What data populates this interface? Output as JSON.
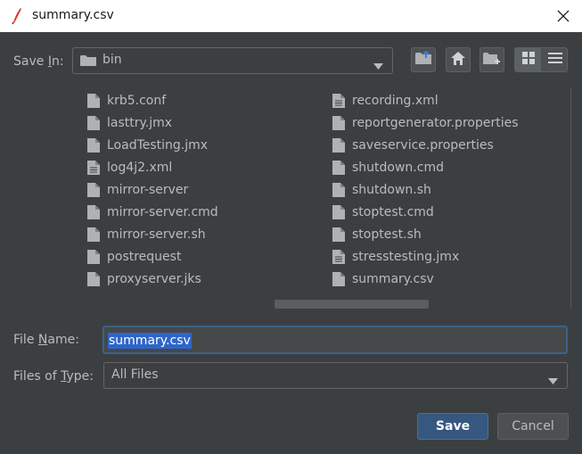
{
  "window": {
    "title": "summary.csv"
  },
  "save_in": {
    "label_pre": "Save ",
    "label_mnemonic": "I",
    "label_post": "n:",
    "value": "bin"
  },
  "files": {
    "left": [
      {
        "name": "krb5.conf",
        "icon": "file-icon"
      },
      {
        "name": "lasttry.jmx",
        "icon": "file-icon"
      },
      {
        "name": "LoadTesting.jmx",
        "icon": "file-icon"
      },
      {
        "name": "log4j2.xml",
        "icon": "text-file-icon"
      },
      {
        "name": "mirror-server",
        "icon": "file-icon"
      },
      {
        "name": "mirror-server.cmd",
        "icon": "file-icon"
      },
      {
        "name": "mirror-server.sh",
        "icon": "file-icon"
      },
      {
        "name": "postrequest",
        "icon": "file-icon"
      },
      {
        "name": "proxyserver.jks",
        "icon": "file-icon"
      }
    ],
    "right": [
      {
        "name": "recording.xml",
        "icon": "text-file-icon"
      },
      {
        "name": "reportgenerator.properties",
        "icon": "file-icon"
      },
      {
        "name": "saveservice.properties",
        "icon": "file-icon"
      },
      {
        "name": "shutdown.cmd",
        "icon": "file-icon"
      },
      {
        "name": "shutdown.sh",
        "icon": "file-icon"
      },
      {
        "name": "stoptest.cmd",
        "icon": "file-icon"
      },
      {
        "name": "stoptest.sh",
        "icon": "file-icon"
      },
      {
        "name": "stresstesting.jmx",
        "icon": "text-file-icon"
      },
      {
        "name": "summary.csv",
        "icon": "file-icon"
      }
    ]
  },
  "file_name": {
    "label_pre": "File ",
    "label_mnemonic": "N",
    "label_post": "ame:",
    "value": "summary.csv"
  },
  "file_type": {
    "label_pre": "Files of ",
    "label_mnemonic": "T",
    "label_post": "ype:",
    "value": "All Files"
  },
  "buttons": {
    "save": "Save",
    "cancel": "Cancel"
  },
  "colors": {
    "background": "#3c3f41",
    "selection": "#2f65ca",
    "primary_button": "#365880"
  }
}
